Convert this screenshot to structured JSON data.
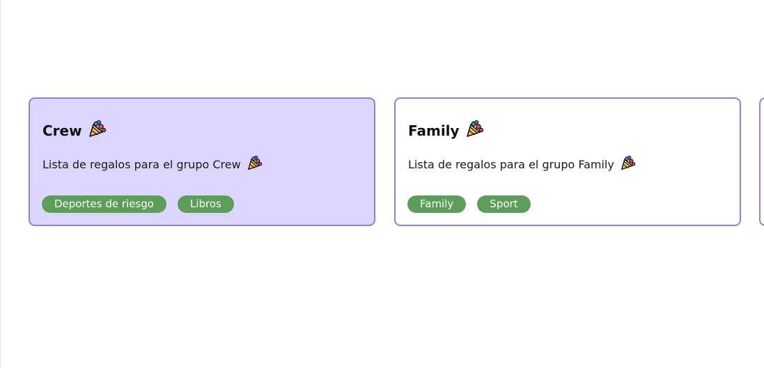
{
  "groups": [
    {
      "title": "Crew",
      "description": "Lista de regalos para el grupo Crew",
      "icon": "party-popper-icon",
      "selected": true,
      "tags": [
        "Deportes de riesgo",
        "Libros"
      ]
    },
    {
      "title": "Family",
      "description": "Lista de regalos para el grupo Family",
      "icon": "party-popper-icon",
      "selected": false,
      "tags": [
        "Family",
        "Sport"
      ]
    }
  ],
  "colors": {
    "card_border": "#8c82db",
    "card_selected_bg": "#dcd6ff",
    "tag_bg": "#5a9e58",
    "tag_text": "#ffffff"
  }
}
